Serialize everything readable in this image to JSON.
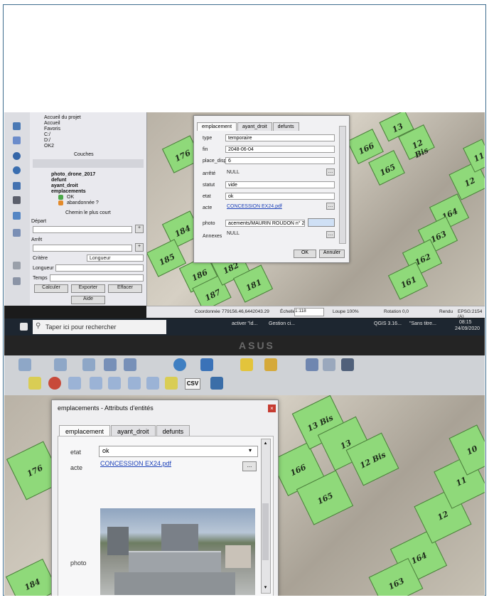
{
  "photo1": {
    "layers_panel": {
      "tree_items": [
        "Accueil du projet",
        "Accueil",
        "Favoris",
        "C:/",
        "D:/",
        "OK2"
      ],
      "title": "Couches",
      "layers": [
        "photo_drone_2017",
        "defunt",
        "ayant_droit",
        "emplacements",
        "OK",
        "abandonnée ?"
      ]
    },
    "route_panel": {
      "title": "Chemin le plus court",
      "depart_label": "Départ",
      "arret_label": "Arrêt",
      "critere_label": "Critère",
      "critere_value": "Longueur",
      "longueur_label": "Longueur",
      "temps_label": "Temps",
      "calculer": "Calculer",
      "exporter": "Exporter",
      "effacer": "Effacer",
      "aide": "Aide"
    },
    "dialog": {
      "tabs": [
        "emplacement",
        "ayant_droit",
        "defunts"
      ],
      "fields": {
        "type_label": "type",
        "type_value": "temporaire",
        "fin_label": "fin",
        "fin_value": "2048-06-04",
        "place_disp_label": "place_disp",
        "place_disp_value": "6",
        "arrete_label": "arrêté",
        "arrete_value": "NULL",
        "statut_label": "statut",
        "statut_value": "vide",
        "etat_label": "etat",
        "etat_value": "ok",
        "acte_label": "acte",
        "acte_value": "CONCESSION EX24.pdf",
        "photo_label": "photo",
        "photo_value": "acements/MAURIN ROUDON n° 24.JPG",
        "annexes_label": "Annexes",
        "annexes_value": "NULL"
      },
      "ok": "OK",
      "annuler": "Annuler"
    },
    "plots": [
      "176",
      "184",
      "185",
      "186",
      "187",
      "182",
      "181",
      "166",
      "165",
      "164",
      "163",
      "162",
      "161",
      "12",
      "11",
      "12 Bis",
      "13"
    ],
    "statusbar": {
      "coordonnee_label": "Coordonnée",
      "coordonnee_value": "779156.46,6442043.29",
      "echelle_label": "Échelle",
      "echelle_value": "1:118",
      "loupe_label": "Loupe",
      "loupe_value": "100%",
      "rotation_label": "Rotation",
      "rotation_value": "0,0",
      "rendu_label": "Rendu",
      "epsg": "EPSG:2154 (A)"
    },
    "taskbar": {
      "search_placeholder": "Taper ici pour rechercher",
      "items": [
        "activer \"id...",
        "Gestion ci...",
        "QGIS 3.16...",
        "\"Sans titre..."
      ],
      "time": "08:15",
      "date": "24/09/2020"
    },
    "laptop_brand": "ASUS"
  },
  "photo2": {
    "toolbar_csv": "CSV",
    "dialog": {
      "title": "emplacements - Attributs d'entités",
      "tabs": [
        "emplacement",
        "ayant_droit",
        "defunts"
      ],
      "etat_label": "etat",
      "etat_value": "ok",
      "acte_label": "acte",
      "acte_value": "CONCESSION EX24.pdf",
      "photo_label": "photo",
      "more_button": "..."
    },
    "plots": [
      "176",
      "184",
      "166",
      "165",
      "164",
      "163",
      "13 Bis",
      "13",
      "12 Bis",
      "12",
      "11",
      "10"
    ]
  },
  "colors": {
    "plot_green": "#8fd97a",
    "frame_border": "#3f6d8f",
    "link_blue": "#1a3fb8"
  }
}
